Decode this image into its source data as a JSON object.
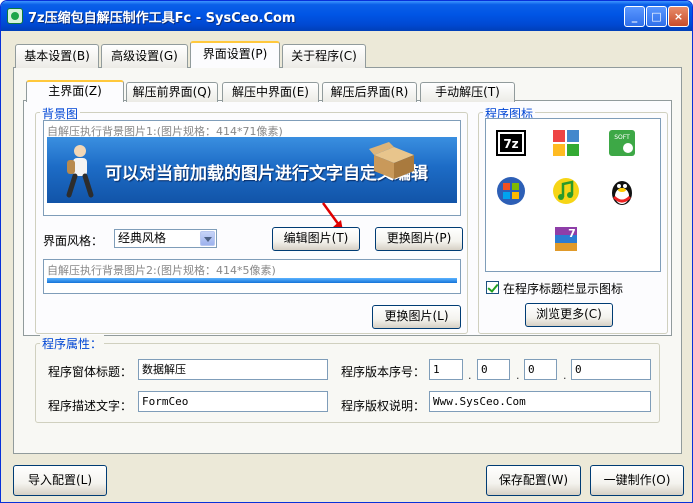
{
  "window": {
    "title": "7z压缩包自解压制作工具Fc - SysCeo.Com",
    "minimize": "_",
    "maximize": "□",
    "close": "×"
  },
  "tabs": [
    "基本设置(B)",
    "高级设置(G)",
    "界面设置(P)",
    "关于程序(C)"
  ],
  "subtabs": [
    "主界面(Z)",
    "解压前界面(Q)",
    "解压中界面(E)",
    "解压后界面(R)",
    "手动解压(T)"
  ],
  "background": {
    "group_label": "背景图",
    "image1_caption": "自解压执行背景图片1:(图片规格：414*71像素)",
    "banner_text": "可以对当前加载的图片进行文字自定义编辑",
    "style_label": "界面风格：",
    "style_value": "经典风格",
    "edit_button": "编辑图片(T)",
    "replace_button1": "更换图片(P)",
    "image2_caption": "自解压执行背景图片2:(图片规格：414*5像素)",
    "replace_button2": "更换图片(L)"
  },
  "program_icon": {
    "group_label": "程序图标",
    "icons": [
      "7z-icon",
      "colored-squares-icon",
      "soft-icon",
      "windows-icon",
      "music-note-icon",
      "qq-penguin-icon",
      "winrar-icon"
    ],
    "show_in_titlebar_label": "在程序标题栏显示图标",
    "show_in_titlebar_checked": true,
    "browse_button": "浏览更多(C)"
  },
  "properties": {
    "group_label": "程序属性：",
    "window_title_label": "程序窗体标题：",
    "window_title_value": "数据解压",
    "version_label": "程序版本序号：",
    "version": [
      "1",
      "0",
      "0",
      "0"
    ],
    "description_label": "程序描述文字：",
    "description_value": "FormCeo",
    "copyright_label": "程序版权说明：",
    "copyright_value": "Www.SysCeo.Com"
  },
  "footer": {
    "import_button": "导入配置(L)",
    "save_button": "保存配置(W)",
    "make_button": "一键制作(O)"
  },
  "colors": {
    "titlebar": "#0055e5",
    "group_label": "#0046d5",
    "banner": "#1d6cc6"
  }
}
